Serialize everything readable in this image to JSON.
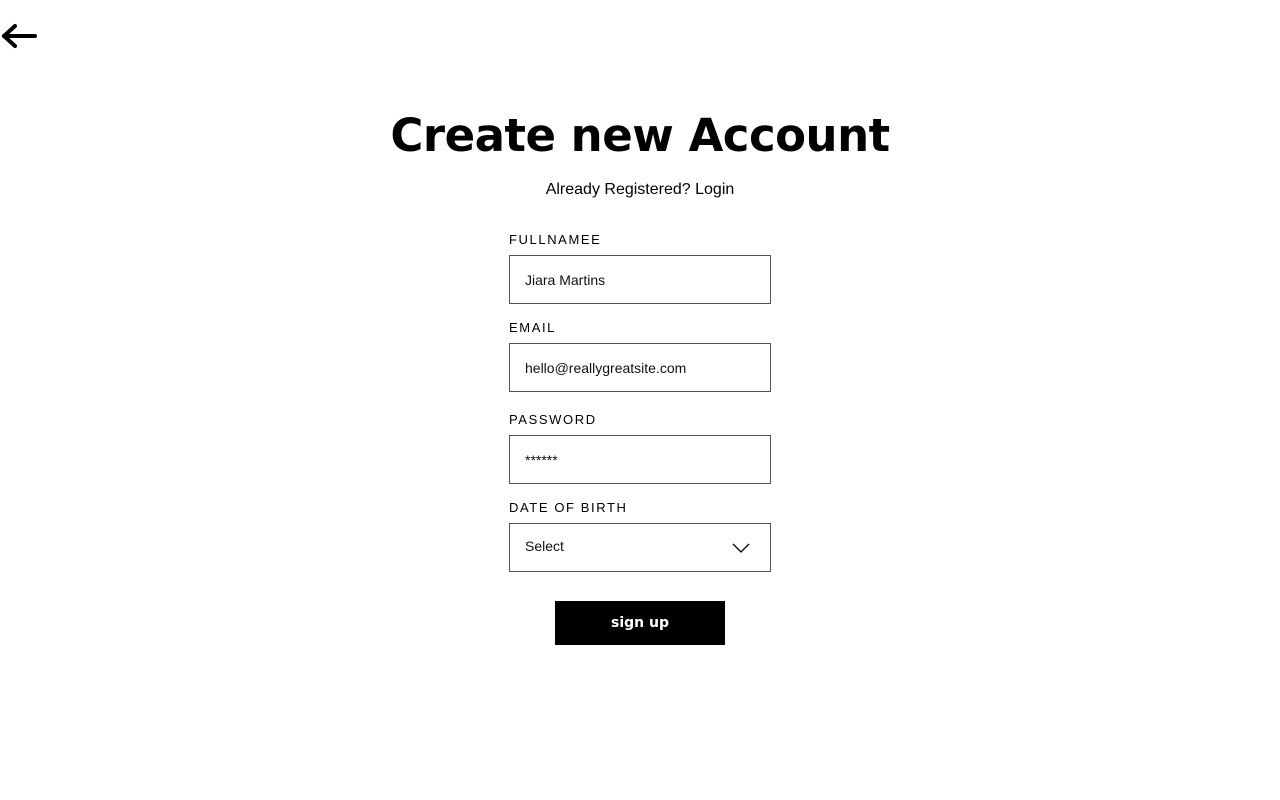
{
  "header": {
    "back_icon": "arrow-left-icon"
  },
  "title": "Create new Account",
  "subtitle": {
    "prompt": "Already Registered? ",
    "login_link": "Login"
  },
  "form": {
    "fullname": {
      "label": "FULLNAMEE",
      "value": "Jiara Martins"
    },
    "email": {
      "label": "EMAIL",
      "value": "hello@reallygreatsite.com"
    },
    "password": {
      "label": "PASSWORD",
      "value": "******"
    },
    "dob": {
      "label": "DATE OF BIRTH",
      "selected": "Select",
      "icon": "chevron-down-icon"
    },
    "submit_label": "sign up"
  },
  "colors": {
    "background": "#ffffff",
    "text": "#000000",
    "button_bg": "#000000",
    "button_text": "#ffffff",
    "field_border": "#555555"
  }
}
